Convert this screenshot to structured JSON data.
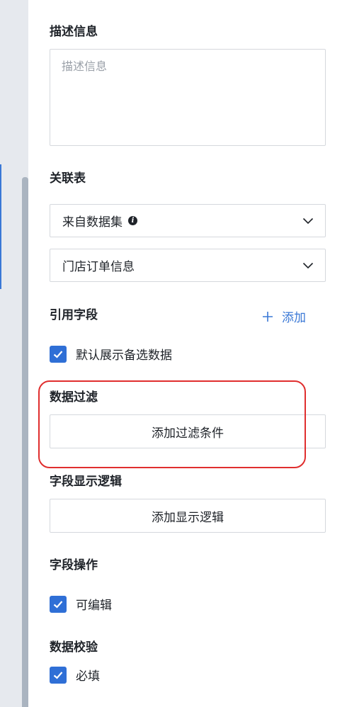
{
  "description": {
    "title": "描述信息",
    "placeholder": "描述信息",
    "value": ""
  },
  "related_table": {
    "title": "关联表",
    "source_select": "来自数据集",
    "source_info_icon": "info-icon",
    "table_select": "门店订单信息"
  },
  "reference_fields": {
    "title": "引用字段",
    "add_label": "添加",
    "default_show": {
      "label": "默认展示备选数据",
      "checked": true
    }
  },
  "data_filter": {
    "title": "数据过滤",
    "add_button": "添加过滤条件"
  },
  "display_logic": {
    "title": "字段显示逻辑",
    "add_button": "添加显示逻辑"
  },
  "field_operations": {
    "title": "字段操作",
    "editable": {
      "label": "可编辑",
      "checked": true
    }
  },
  "validation": {
    "title": "数据校验",
    "required": {
      "label": "必填",
      "checked": true
    }
  },
  "colors": {
    "accent": "#2f6fd6",
    "link": "#3a78d6",
    "highlight": "#e02e2e",
    "border": "#d5d8dd"
  }
}
